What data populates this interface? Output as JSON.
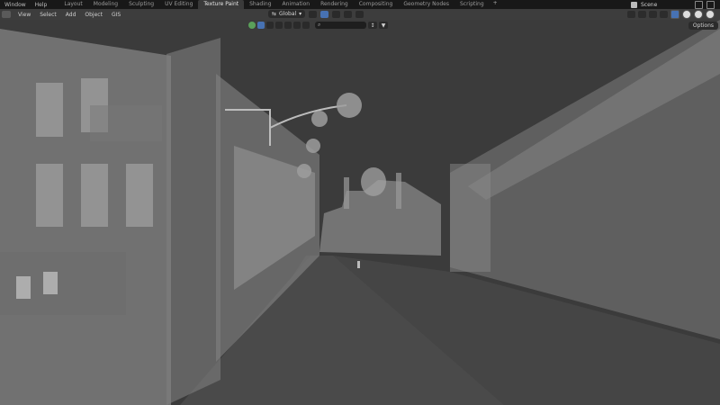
{
  "topbar": {
    "menus": [
      "Window",
      "Help"
    ],
    "workspaces": [
      "Layout",
      "Modeling",
      "Sculpting",
      "UV Editing",
      "Texture Paint",
      "Shading",
      "Animation",
      "Rendering",
      "Compositing",
      "Geometry Nodes",
      "Scripting"
    ],
    "active_workspace": "Texture Paint",
    "add_tab": "+",
    "scene_name": "Scene"
  },
  "viewport_header": {
    "menus": [
      "View",
      "Select",
      "Add",
      "Object",
      "GIS"
    ],
    "orientation": "Global",
    "search_placeholder": "",
    "options_label": "Options"
  },
  "colors": {
    "background": "#3d3d3d",
    "topbar": "#181818",
    "accent": "#4772b3"
  }
}
